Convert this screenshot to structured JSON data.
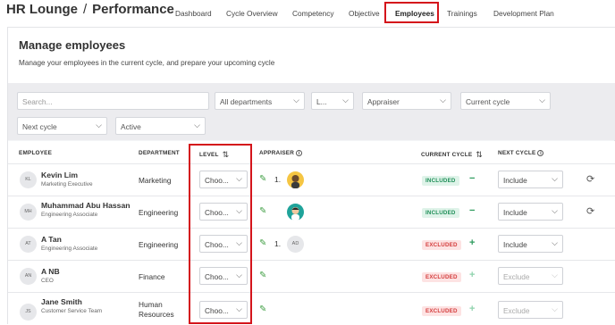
{
  "header": {
    "brand": "HR Lounge",
    "separator": "/",
    "section": "Performance",
    "nav": [
      {
        "label": "Dashboard"
      },
      {
        "label": "Cycle Overview"
      },
      {
        "label": "Competency"
      },
      {
        "label": "Objective"
      },
      {
        "label": "Employees",
        "active": true
      },
      {
        "label": "Trainings"
      },
      {
        "label": "Development Plan"
      }
    ]
  },
  "page": {
    "title": "Manage employees",
    "subtitle": "Manage your employees in the current cycle, and prepare your upcoming cycle"
  },
  "filters": {
    "search_placeholder": "Search...",
    "department": "All departments",
    "level": "L...",
    "appraiser": "Appraiser",
    "current_cycle": "Current cycle",
    "next_cycle": "Next cycle",
    "status": "Active"
  },
  "table": {
    "headers": {
      "employee": "EMPLOYEE",
      "department": "DEPARTMENT",
      "level": "LEVEL",
      "appraiser": "APPRAISER",
      "current_cycle": "CURRENT CYCLE",
      "next_cycle": "NEXT CYCLE"
    },
    "rows": [
      {
        "initials": "KL",
        "name": "Kevin Lim",
        "title": "Marketing Executive",
        "department": "Marketing",
        "level": "Choo...",
        "appraiser_num": "1.",
        "appraiser_avatar": "avatar-yellow",
        "cycle_badge": "INCLUDED",
        "cycle_action": "−",
        "next_cycle": "Include"
      },
      {
        "initials": "MH",
        "name": "Muhammad Abu Hassan",
        "title": "Engineering Associate",
        "department": "Engineering",
        "level": "Choo...",
        "appraiser_num": "",
        "appraiser_avatar": "avatar-teal",
        "cycle_badge": "INCLUDED",
        "cycle_action": "−",
        "next_cycle": "Include"
      },
      {
        "initials": "AT",
        "name": "A Tan",
        "title": "Engineering Associate",
        "department": "Engineering",
        "level": "Choo...",
        "appraiser_num": "1.",
        "appraiser_initials": "AD",
        "cycle_badge": "EXCLUDED",
        "cycle_action": "+",
        "next_cycle": "Include"
      },
      {
        "initials": "AN",
        "name": "A NB",
        "title": "CEO",
        "department": "Finance",
        "level": "Choo...",
        "cycle_badge": "EXCLUDED",
        "cycle_action": "+",
        "next_cycle": "Exclude"
      },
      {
        "initials": "JS",
        "name": "Jane Smith",
        "title": "Customer Service Team",
        "department_line1": "Human",
        "department_line2": "Resources",
        "level": "Choo...",
        "cycle_badge": "EXCLUDED",
        "cycle_action": "+",
        "next_cycle": "Exclude"
      }
    ]
  },
  "icons": {
    "chevron": "chevron-down-icon",
    "edit": "pencil-icon",
    "refresh": "refresh-icon",
    "sort": "sort-icon",
    "info": "info-icon"
  },
  "colors": {
    "highlight": "#d4141b",
    "included_bg": "#dff3e9",
    "included_text": "#1f8f58",
    "excluded_bg": "#fde3e3",
    "excluded_text": "#d43b3b",
    "green": "#43a047"
  }
}
